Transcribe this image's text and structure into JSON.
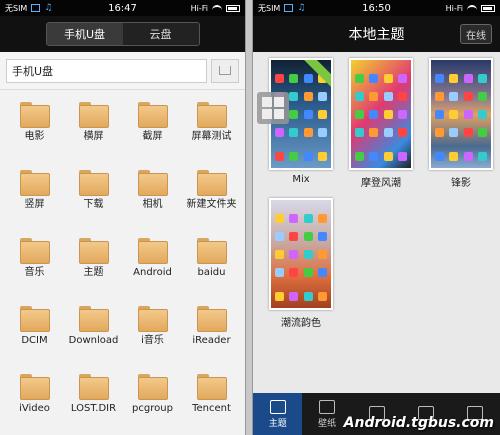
{
  "left": {
    "status": {
      "carrier": "无SIM",
      "time": "16:47",
      "signal": "Hi-Fi"
    },
    "segments": [
      {
        "label": "手机U盘",
        "active": true
      },
      {
        "label": "云盘",
        "active": false
      }
    ],
    "path": "手机U盘",
    "folders": [
      "电影",
      "横屏",
      "截屏",
      "屏幕测试",
      "竖屏",
      "下载",
      "相机",
      "新建文件夹",
      "音乐",
      "主题",
      "Android",
      "baidu",
      "DCIM",
      "Download",
      "i音乐",
      "iReader",
      "iVideo",
      "LOST.DIR",
      "pcgroup",
      "Tencent"
    ]
  },
  "right": {
    "status": {
      "carrier": "无SIM",
      "time": "16:50",
      "signal": "Hi-Fi"
    },
    "title": "本地主题",
    "online_label": "在线",
    "themes": [
      {
        "name": "Mix",
        "style": "t1"
      },
      {
        "name": "摩登风潮",
        "style": "t2"
      },
      {
        "name": "锋影",
        "style": "t3"
      },
      {
        "name": "潮流韵色",
        "style": "t4"
      }
    ],
    "tabs": [
      {
        "label": "主题",
        "active": true
      },
      {
        "label": "壁纸",
        "active": false
      },
      {
        "label": "",
        "active": false
      },
      {
        "label": "",
        "active": false
      },
      {
        "label": "",
        "active": false
      }
    ],
    "watermark": "Android.tgbus.com"
  }
}
